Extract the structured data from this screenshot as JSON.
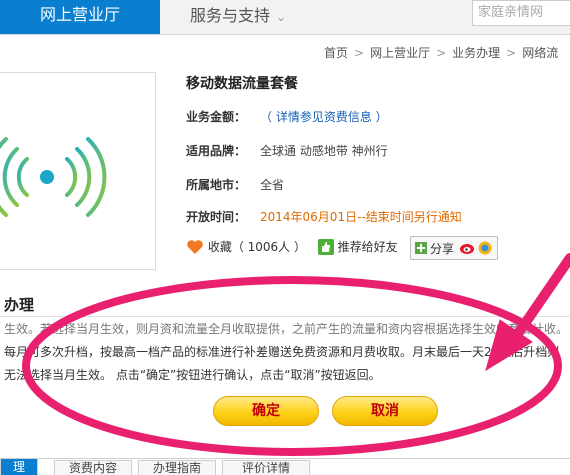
{
  "nav": {
    "active_label": "网上营业厅",
    "service_label": "服务与支持",
    "search_placeholder": "家庭亲情网"
  },
  "breadcrumb": [
    "首页",
    "网上营业厅",
    "业务办理",
    "网络流"
  ],
  "product": {
    "title": "移动数据流量套餐",
    "rows": [
      {
        "label": "业务金额：",
        "value": "（ 详情参见资费信息 ）"
      },
      {
        "label": "适用品牌：",
        "value": "全球通  动感地带  神州行"
      },
      {
        "label": "所属地市：",
        "value": "全省"
      },
      {
        "label": "开放时间：",
        "value": "2014年06月01日--结束时间另行通知"
      }
    ],
    "favorite_label": "收藏（ 1006人 ）",
    "recommend_label": "推荐给好友",
    "share_label": "分享"
  },
  "section": {
    "title": "办理",
    "lines": [
      "生效。若选择当月生效，则月资和流量全月收取提供，之前产生的流量和资内容根据选择生效的套餐计收。",
      "每月可多次升档，按最高一档产品的标准进行补差赠送免费资源和月费收取。月末最后一天21点后升档则",
      "无法选择当月生效。 点击“确定”按钮进行确认，点击“取消”按钮返回。"
    ]
  },
  "buttons": {
    "confirm": "确定",
    "cancel": "取消"
  },
  "bottom_tabs": [
    "理",
    "资费内容",
    "办理指南",
    "评价详情"
  ],
  "colors": {
    "brand_blue": "#0a7fd0",
    "annotation_pink": "#e8206e",
    "button_yellow": "#ffd21a",
    "date_orange": "#e06a00"
  }
}
